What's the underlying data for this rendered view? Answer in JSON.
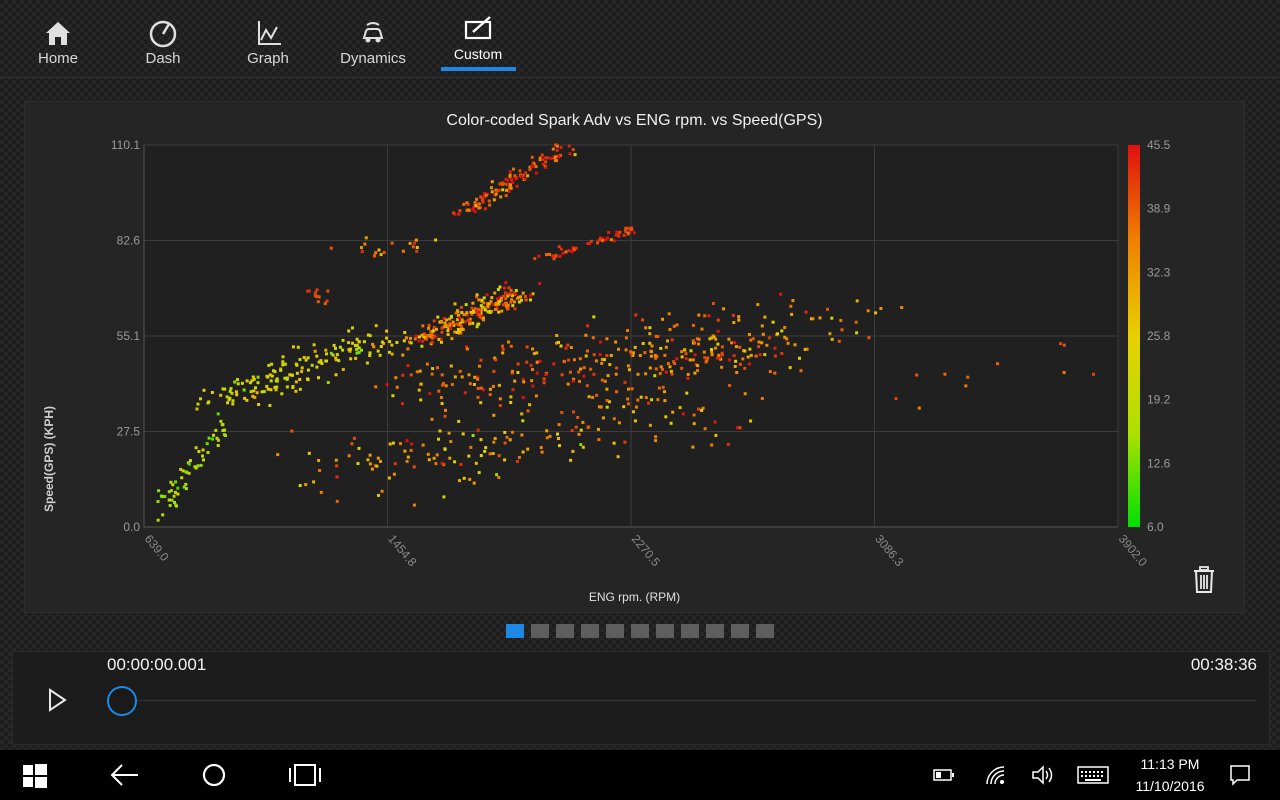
{
  "nav": {
    "items": [
      {
        "label": "Home",
        "icon": "home-icon"
      },
      {
        "label": "Dash",
        "icon": "gauge-icon"
      },
      {
        "label": "Graph",
        "icon": "graph-icon"
      },
      {
        "label": "Dynamics",
        "icon": "car-dynamics-icon"
      },
      {
        "label": "Custom",
        "icon": "edit-icon"
      }
    ],
    "active": "Custom"
  },
  "chart_data": {
    "type": "scatter",
    "title": "Color-coded Spark Adv vs ENG rpm. vs Speed(GPS)",
    "xlabel": "ENG rpm. (RPM)",
    "ylabel": "Speed(GPS) (KPH)",
    "x_ticks": [
      "639.0",
      "1454.8",
      "2270.5",
      "3086.3",
      "3902.0"
    ],
    "y_ticks": [
      "0.0",
      "27.5",
      "55.1",
      "82.6",
      "110.1"
    ],
    "xlim": [
      639.0,
      3902.0
    ],
    "ylim": [
      0.0,
      110.1
    ],
    "grid": true,
    "colorbar": {
      "label_values": [
        "45.5",
        "38.9",
        "32.3",
        "25.8",
        "19.2",
        "12.6",
        "6.0"
      ],
      "range": [
        6.0,
        45.5
      ],
      "colors": [
        "#00e000",
        "#b0e000",
        "#e8d000",
        "#f08000",
        "#e01010"
      ]
    },
    "clusters": [
      {
        "from": [
          1700,
          90
        ],
        "to": [
          2050,
          110
        ],
        "c": 40,
        "n": 120,
        "spread": [
          40,
          1.5
        ],
        "cvar": 10
      },
      {
        "from": [
          1950,
          77
        ],
        "to": [
          2290,
          86
        ],
        "c": 42,
        "n": 50,
        "spread": [
          30,
          1
        ],
        "cvar": 6
      },
      {
        "from": [
          1550,
          53
        ],
        "to": [
          1900,
          68
        ],
        "c": 35,
        "n": 220,
        "spread": [
          60,
          2.5
        ],
        "cvar": 14
      },
      {
        "from": [
          1100,
          45
        ],
        "to": [
          1500,
          55
        ],
        "c": 24,
        "n": 90,
        "spread": [
          90,
          4
        ],
        "cvar": 8
      },
      {
        "from": [
          850,
          36
        ],
        "to": [
          1200,
          44
        ],
        "c": 22,
        "n": 80,
        "spread": [
          60,
          4
        ],
        "cvar": 8
      },
      {
        "from": [
          700,
          5
        ],
        "to": [
          900,
          30
        ],
        "c": 17,
        "n": 60,
        "spread": [
          30,
          3
        ],
        "cvar": 6
      },
      {
        "from": [
          1600,
          40
        ],
        "to": [
          2700,
          55
        ],
        "c": 36,
        "n": 260,
        "spread": [
          220,
          8
        ],
        "cvar": 10
      },
      {
        "from": [
          1200,
          15
        ],
        "to": [
          2500,
          35
        ],
        "c": 32,
        "n": 180,
        "spread": [
          260,
          9
        ],
        "cvar": 12
      },
      {
        "from": [
          2300,
          45
        ],
        "to": [
          3000,
          62
        ],
        "c": 34,
        "n": 80,
        "spread": [
          200,
          7
        ],
        "cvar": 10
      },
      {
        "from": [
          1300,
          78
        ],
        "to": [
          1600,
          82
        ],
        "c": 36,
        "n": 20,
        "spread": [
          80,
          2
        ],
        "cvar": 8
      },
      {
        "from": [
          1150,
          68
        ],
        "to": [
          1250,
          66
        ],
        "c": 40,
        "n": 12,
        "spread": [
          10,
          1.5
        ],
        "cvar": 3
      },
      {
        "from": [
          3100,
          40
        ],
        "to": [
          3900,
          50
        ],
        "c": 40,
        "n": 12,
        "spread": [
          250,
          6
        ],
        "cvar": 4
      }
    ]
  },
  "pager": {
    "count": 11,
    "active_index": 0
  },
  "player": {
    "time_current": "00:00:00.001",
    "time_total": "00:38:36",
    "progress_fraction": 0.0
  },
  "taskbar": {
    "time": "11:13 PM",
    "date": "11/10/2016"
  }
}
